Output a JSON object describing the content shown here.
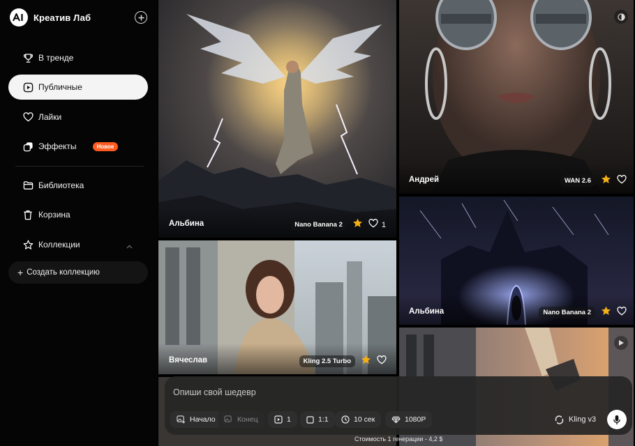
{
  "app": {
    "name": "Креатив Лаб"
  },
  "sidebar": {
    "items": [
      {
        "label": "В тренде",
        "icon": "trophy-icon"
      },
      {
        "label": "Публичные",
        "icon": "play-square-icon",
        "active": true
      },
      {
        "label": "Лайки",
        "icon": "heart-icon"
      },
      {
        "label": "Эффекты",
        "icon": "effects-icon",
        "badge": "Новое"
      },
      {
        "label": "Библиотека",
        "icon": "folder-icon"
      },
      {
        "label": "Корзина",
        "icon": "trash-icon"
      },
      {
        "label": "Коллекции",
        "icon": "star-icon",
        "expanded": true
      }
    ],
    "create_collection": "Создать коллекцию"
  },
  "gallery": {
    "tiles": [
      {
        "author": "Альбина",
        "model": "Nano Banana 2",
        "likes": "1",
        "starred": true
      },
      {
        "author": "Андрей",
        "model": "WAN 2.6",
        "likes": "",
        "starred": true
      },
      {
        "author": "Вячеслав",
        "model": "Kling 2.5 Turbo",
        "likes": "",
        "starred": true
      },
      {
        "author": "Альбина",
        "model": "Nano Banana 2",
        "likes": "",
        "starred": true
      },
      {
        "author": "",
        "model": "",
        "likes": "",
        "starred": false
      }
    ]
  },
  "prompt": {
    "placeholder": "Опиши свой шедевр",
    "start_frame": "Начало",
    "end_frame": "Конец",
    "count": "1",
    "aspect": "1:1",
    "duration": "10 сек",
    "quality": "1080P",
    "model": "Kling v3",
    "cost": "Стоимость 1 генерации - 4,2 $"
  },
  "colors": {
    "accent": "#ff5a1f",
    "star": "#f5b016",
    "active_nav_bg": "#f4f4f4"
  }
}
